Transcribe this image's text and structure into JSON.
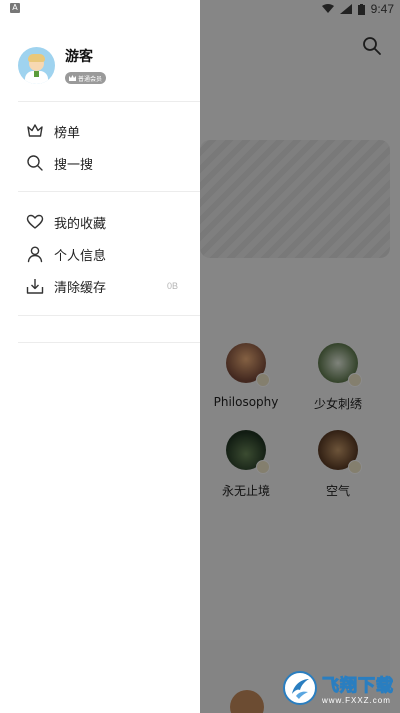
{
  "status_bar": {
    "time": "9:47",
    "left_badge": "A"
  },
  "profile": {
    "name": "游客",
    "badge_text": "普通会员"
  },
  "menu": {
    "ranking": "榜单",
    "search": "搜一搜",
    "favorites": "我的收藏",
    "personal_info": "个人信息",
    "clear_cache": "清除缓存",
    "cache_size": "0B"
  },
  "background": {
    "grid": [
      {
        "label": "Philosophy"
      },
      {
        "label": "少女刺绣"
      },
      {
        "label": "永无止境"
      },
      {
        "label": "空气"
      }
    ]
  },
  "watermark": {
    "title": "飞翔下载",
    "subtitle": "www.FXXZ.com"
  },
  "colors": {
    "scrim": "#000000",
    "drawer_bg": "#ffffff",
    "divider": "#ececec",
    "wm_blue": "#2a7ec0"
  }
}
